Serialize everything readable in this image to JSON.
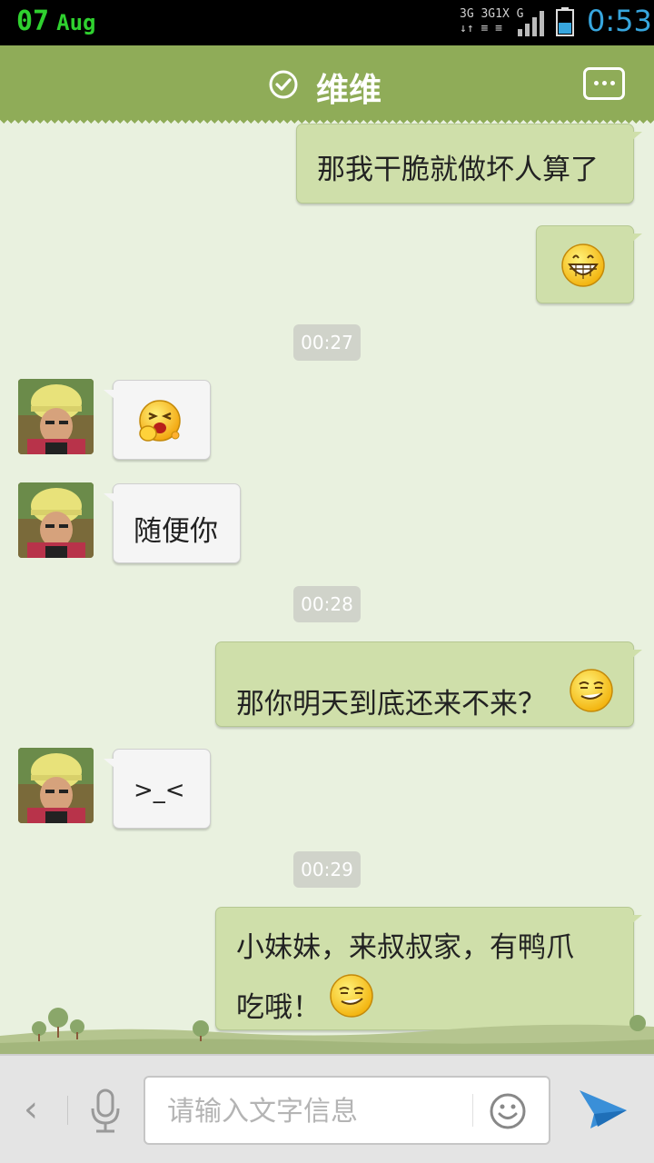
{
  "status_bar": {
    "date_day": "07",
    "date_month": "Aug",
    "net": [
      "3G",
      "3G",
      "1X",
      "G"
    ],
    "time": "0:53"
  },
  "header": {
    "title": "维维",
    "verified_icon": "check-circle-icon",
    "more_icon": "more-dots-icon"
  },
  "messages": [
    {
      "type": "out-text",
      "text": "那我干脆就做坏人算了"
    },
    {
      "type": "out-emoji",
      "emoji": "grin-icon"
    },
    {
      "type": "time",
      "text": "00:27"
    },
    {
      "type": "in-emoji",
      "emoji": "yawn-icon"
    },
    {
      "type": "in-text",
      "text": "随便你"
    },
    {
      "type": "time",
      "text": "00:28"
    },
    {
      "type": "out-text",
      "text": "那你明天到底还来不来？"
    },
    {
      "type": "in-text",
      "text": ">_<"
    },
    {
      "type": "time",
      "text": "00:29"
    },
    {
      "type": "out-text",
      "lines": [
        "小妹妹，来叔叔家，有鸭爪",
        "吃哦！"
      ]
    }
  ],
  "input_bar": {
    "back_glyph": "‹",
    "placeholder": "请输入文字信息"
  },
  "colors": {
    "header_green": "#8fac58",
    "out_bubble": "#cfdfaa",
    "in_bubble": "#f5f5f5",
    "background": "#e9f1df",
    "send_blue": "#3a8fd8",
    "status_green": "#2fd12f",
    "status_blue": "#37a6de"
  }
}
